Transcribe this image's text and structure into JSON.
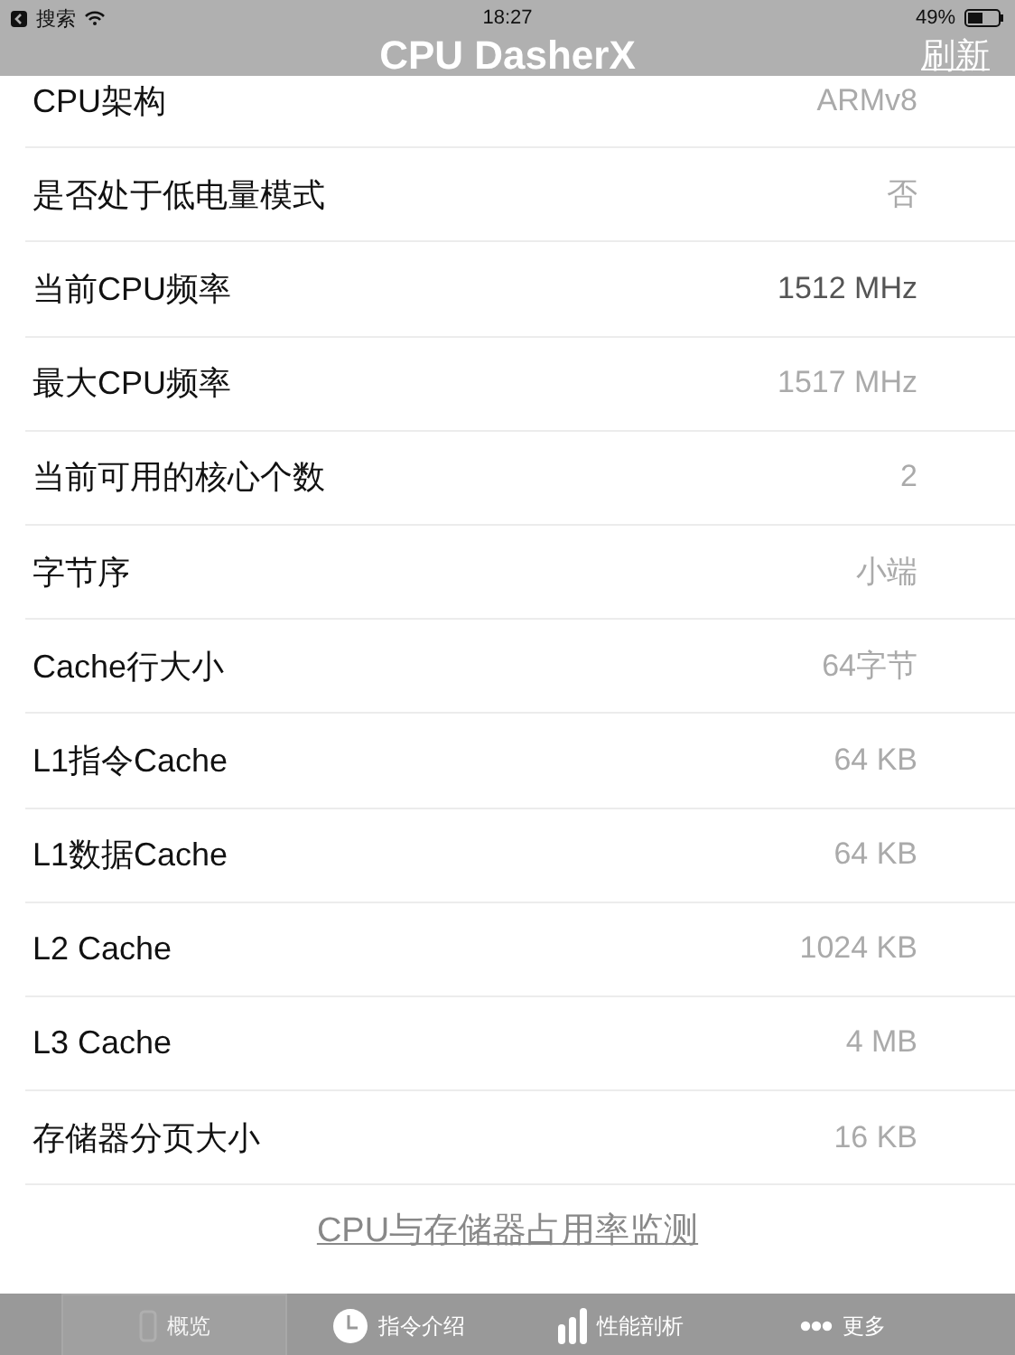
{
  "status_bar": {
    "back": "搜索",
    "time": "18:27",
    "battery": "49%"
  },
  "nav": {
    "title": "CPU DasherX",
    "action": "刷新"
  },
  "rows": [
    {
      "label": "CPU架构",
      "value": "ARMv8",
      "highlighted": false
    },
    {
      "label": "是否处于低电量模式",
      "value": "否",
      "highlighted": false
    },
    {
      "label": "当前CPU频率",
      "value": "1512 MHz",
      "highlighted": true
    },
    {
      "label": "最大CPU频率",
      "value": "1517 MHz",
      "highlighted": false
    },
    {
      "label": "当前可用的核心个数",
      "value": "2",
      "highlighted": false
    },
    {
      "label": "字节序",
      "value": "小端",
      "highlighted": false
    },
    {
      "label": "Cache行大小",
      "value": "64字节",
      "highlighted": false
    },
    {
      "label": "L1指令Cache",
      "value": "64 KB",
      "highlighted": false
    },
    {
      "label": "L1数据Cache",
      "value": "64 KB",
      "highlighted": false
    },
    {
      "label": "L2 Cache",
      "value": "1024 KB",
      "highlighted": false
    },
    {
      "label": "L3 Cache",
      "value": "4 MB",
      "highlighted": false
    },
    {
      "label": "存储器分页大小",
      "value": "16 KB",
      "highlighted": false
    }
  ],
  "link": "CPU与存储器占用率监测",
  "tabs": [
    {
      "kind": "device",
      "label": "概览",
      "selected": true
    },
    {
      "kind": "clock",
      "label": "指令介绍",
      "selected": false
    },
    {
      "kind": "bars",
      "label": "性能剖析",
      "selected": false
    },
    {
      "kind": "more",
      "label": "更多",
      "selected": false
    }
  ]
}
